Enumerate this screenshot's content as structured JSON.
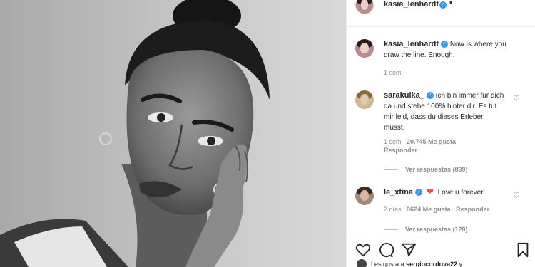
{
  "post": {
    "author": "kasia_lenhardt",
    "header_separator": "•",
    "caption": "Now is where you draw the line. Enough.",
    "caption_age": "1 sem"
  },
  "comments": [
    {
      "username": "sarakulka_",
      "text": "Ich bin immer für dich da und stehe 100% hinter dir. Es tut mir leid, dass du dieses Erleben musst.",
      "age": "1 sem",
      "likes": "20.745 Me gusta",
      "reply_label": "Responder",
      "replies_label": "Ver respuestas (899)"
    },
    {
      "username": "le_xtina",
      "text": "Love u forever",
      "emoji": "❤",
      "age": "2 días",
      "likes": "9624 Me gusta",
      "reply_label": "Responder",
      "replies_label": "Ver respuestas (120)"
    }
  ],
  "actions": {
    "like_icon": "heart-icon",
    "comment_icon": "comment-bubble-icon",
    "share_icon": "paper-plane-icon",
    "save_icon": "bookmark-icon"
  },
  "likes_prefix": "Les gusta a",
  "likes_user": "sergiocordova22",
  "likes_suffix": "y",
  "colors": {
    "verified": "#3897f0",
    "heart": "#ed4956",
    "muted": "#8e8e8e"
  }
}
